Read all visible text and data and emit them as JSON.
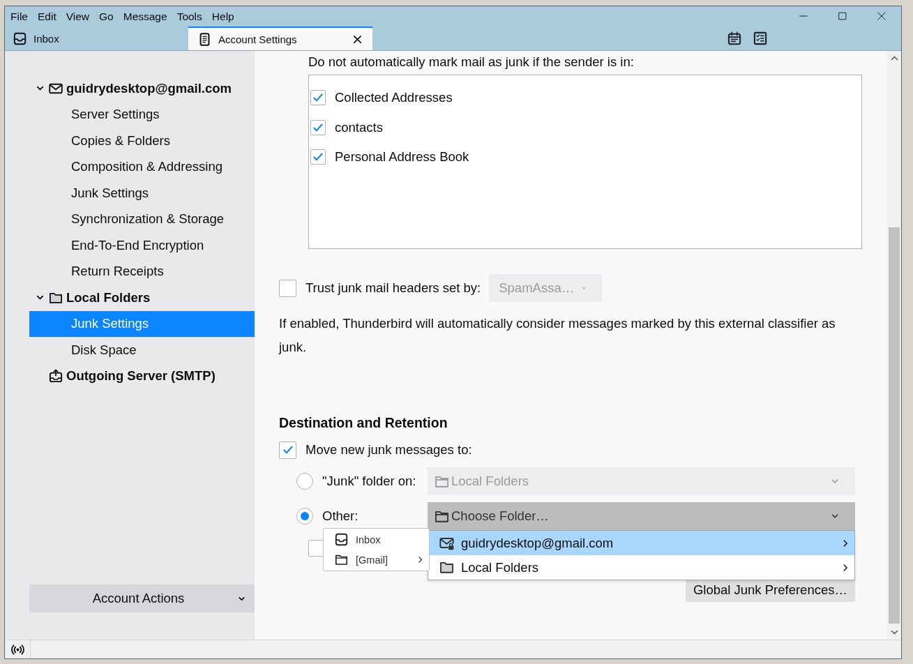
{
  "menu_bar": [
    "File",
    "Edit",
    "View",
    "Go",
    "Message",
    "Tools",
    "Help"
  ],
  "tabs": [
    {
      "label": "Inbox",
      "selected": false,
      "closable": false
    },
    {
      "label": "Account Settings",
      "selected": true,
      "closable": true
    }
  ],
  "sidebar": {
    "items": [
      {
        "label": "guidrydesktop@gmail.com",
        "expanded": true,
        "selected": false,
        "children": [
          {
            "label": "Server Settings",
            "selected": false
          },
          {
            "label": "Copies & Folders",
            "selected": false
          },
          {
            "label": "Composition & Addressing",
            "selected": false
          },
          {
            "label": "Junk Settings",
            "selected": false
          },
          {
            "label": "Synchronization & Storage",
            "selected": false
          },
          {
            "label": "End-To-End Encryption",
            "selected": false
          },
          {
            "label": "Return Receipts",
            "selected": false
          }
        ]
      },
      {
        "label": "Local Folders",
        "expanded": true,
        "selected": false,
        "children": [
          {
            "label": "Junk Settings",
            "selected": true
          },
          {
            "label": "Disk Space",
            "selected": false
          }
        ]
      },
      {
        "label": "Outgoing Server (SMTP)",
        "selected": false
      }
    ],
    "account_actions": "Account Actions"
  },
  "whitelist": {
    "label": "Do not automatically mark mail as junk if the sender is in:",
    "items": [
      {
        "label": "Collected Addresses",
        "checked": true
      },
      {
        "label": "contacts",
        "checked": true
      },
      {
        "label": "Personal Address Book",
        "checked": true
      }
    ]
  },
  "trust_headers": {
    "label": "Trust junk mail headers set by:",
    "checked": false,
    "dropdown": {
      "value": "SpamAssa…",
      "disabled": true,
      "open": false
    }
  },
  "note": "If enabled, Thunderbird will automatically consider messages marked by this external classifier as junk.",
  "destination": {
    "heading": "Destination and Retention",
    "move": {
      "label": "Move new junk messages to:",
      "checked": true
    },
    "options": [
      {
        "label": "\"Junk\" folder on:",
        "selected": false,
        "dropdown": {
          "value": "Local Folders",
          "disabled": true,
          "open": false
        }
      },
      {
        "label": "Other:",
        "selected": true,
        "dropdown": {
          "value": "Choose Folder…",
          "disabled": false,
          "open": true
        }
      }
    ],
    "extra_checkbox": {
      "checked": false
    }
  },
  "folder_menu": [
    {
      "label": "guidrydesktop@gmail.com",
      "selected": true
    },
    {
      "label": "Local Folders",
      "selected": false
    }
  ],
  "submenu": [
    {
      "label": "Inbox",
      "has_submenu": false
    },
    {
      "label": "[Gmail]",
      "has_submenu": true
    }
  ],
  "global_button": "Global Junk Preferences…"
}
